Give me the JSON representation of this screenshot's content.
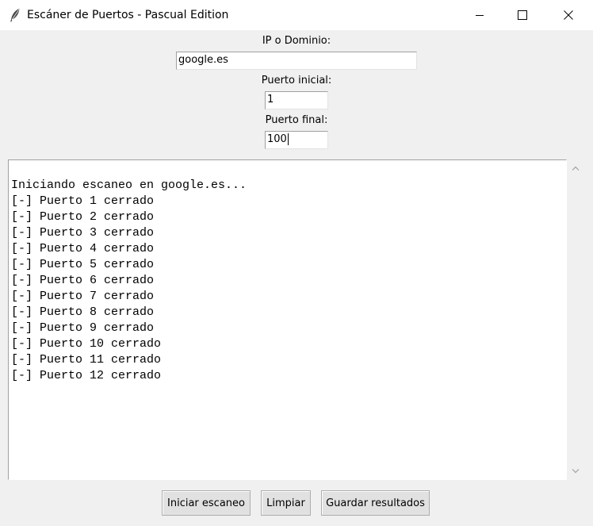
{
  "window": {
    "title": "Escáner de Puertos - Pascual Edition",
    "app_icon": "feather-icon"
  },
  "form": {
    "ip_label": "IP o Dominio:",
    "ip_value": "google.es",
    "start_label": "Puerto inicial:",
    "start_value": "1",
    "end_label": "Puerto final:",
    "end_value": "100"
  },
  "output": {
    "lines": [
      "Iniciando escaneo en google.es...",
      "[-] Puerto 1 cerrado",
      "[-] Puerto 2 cerrado",
      "[-] Puerto 3 cerrado",
      "[-] Puerto 4 cerrado",
      "[-] Puerto 5 cerrado",
      "[-] Puerto 6 cerrado",
      "[-] Puerto 7 cerrado",
      "[-] Puerto 8 cerrado",
      "[-] Puerto 9 cerrado",
      "[-] Puerto 10 cerrado",
      "[-] Puerto 11 cerrado",
      "[-] Puerto 12 cerrado"
    ]
  },
  "buttons": {
    "start": "Iniciar escaneo",
    "clear": "Limpiar",
    "save": "Guardar resultados"
  }
}
